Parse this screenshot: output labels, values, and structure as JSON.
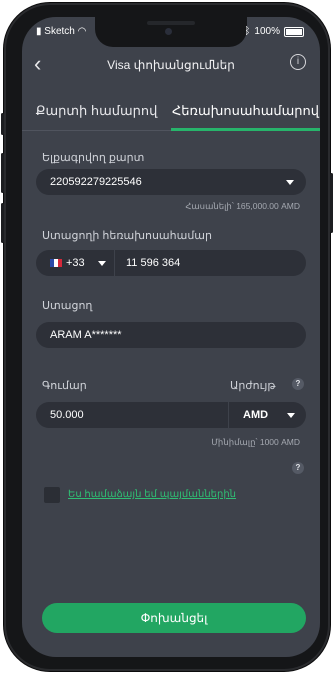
{
  "status_bar": {
    "carrier": "Sketch",
    "battery": "100%"
  },
  "header": {
    "title": "Visa փոխանցումներ",
    "back_icon": "‹",
    "info_icon": "i"
  },
  "tabs": [
    {
      "label": "Քարտի համարով",
      "active": false
    },
    {
      "label": "Հեռախոսահամարով",
      "active": true
    }
  ],
  "form": {
    "sender_card": {
      "label": "Ելքագրվող քարտ",
      "value": "220592279225546",
      "available": "Հասանելի՝ 165,000.00 AMD"
    },
    "recipient_phone": {
      "label": "Ստացողի հեռախոսահամար",
      "country_code": "+33",
      "number": "11 596 364"
    },
    "recipient": {
      "label": "Ստացող",
      "value": "ARAM A*******"
    },
    "amount": {
      "label": "Գումար",
      "currency_label": "Արժույթ",
      "value": "50.000",
      "currency": "AMD",
      "minimum": "Մինիմալը՝ 1000 AMD"
    },
    "help_icon": "?",
    "terms_link": "Ես համաձայն եմ պայմաններին"
  },
  "submit_label": "Փոխանցել",
  "colors": {
    "accent": "#27b46b",
    "background": "#3e424b",
    "field": "#2d3038",
    "button": "#22a662"
  }
}
